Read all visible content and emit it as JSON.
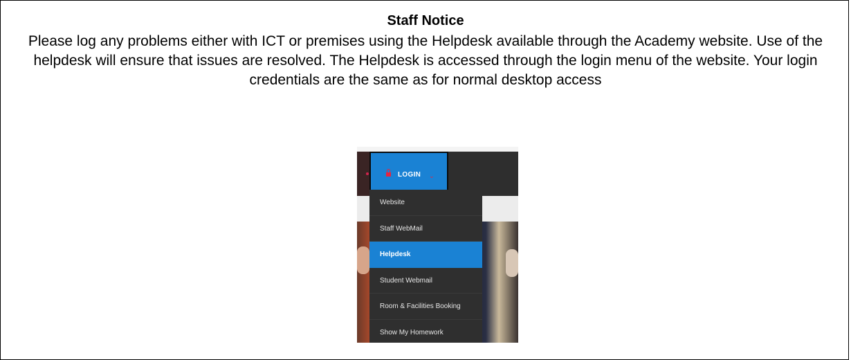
{
  "notice": {
    "title": "Staff Notice",
    "body": "Please log any problems either with ICT or premises using the Helpdesk available through the Academy website. Use of the helpdesk will ensure that issues are resolved. The Helpdesk is accessed through the login menu of the website. Your login credentials are the same as for normal desktop access"
  },
  "screenshot": {
    "login_label": "LOGIN",
    "login_icon": "lock-icon",
    "menu_items": [
      {
        "label": "Website",
        "active": false
      },
      {
        "label": "Staff WebMail",
        "active": false
      },
      {
        "label": "Helpdesk",
        "active": true
      },
      {
        "label": "Student Webmail",
        "active": false
      },
      {
        "label": "Room & Facilities Booking",
        "active": false
      },
      {
        "label": "Show My Homework",
        "active": false
      }
    ],
    "colors": {
      "accent": "#1a82d4",
      "menu_bg": "#2f2f2f",
      "lock": "#e8243f"
    }
  }
}
